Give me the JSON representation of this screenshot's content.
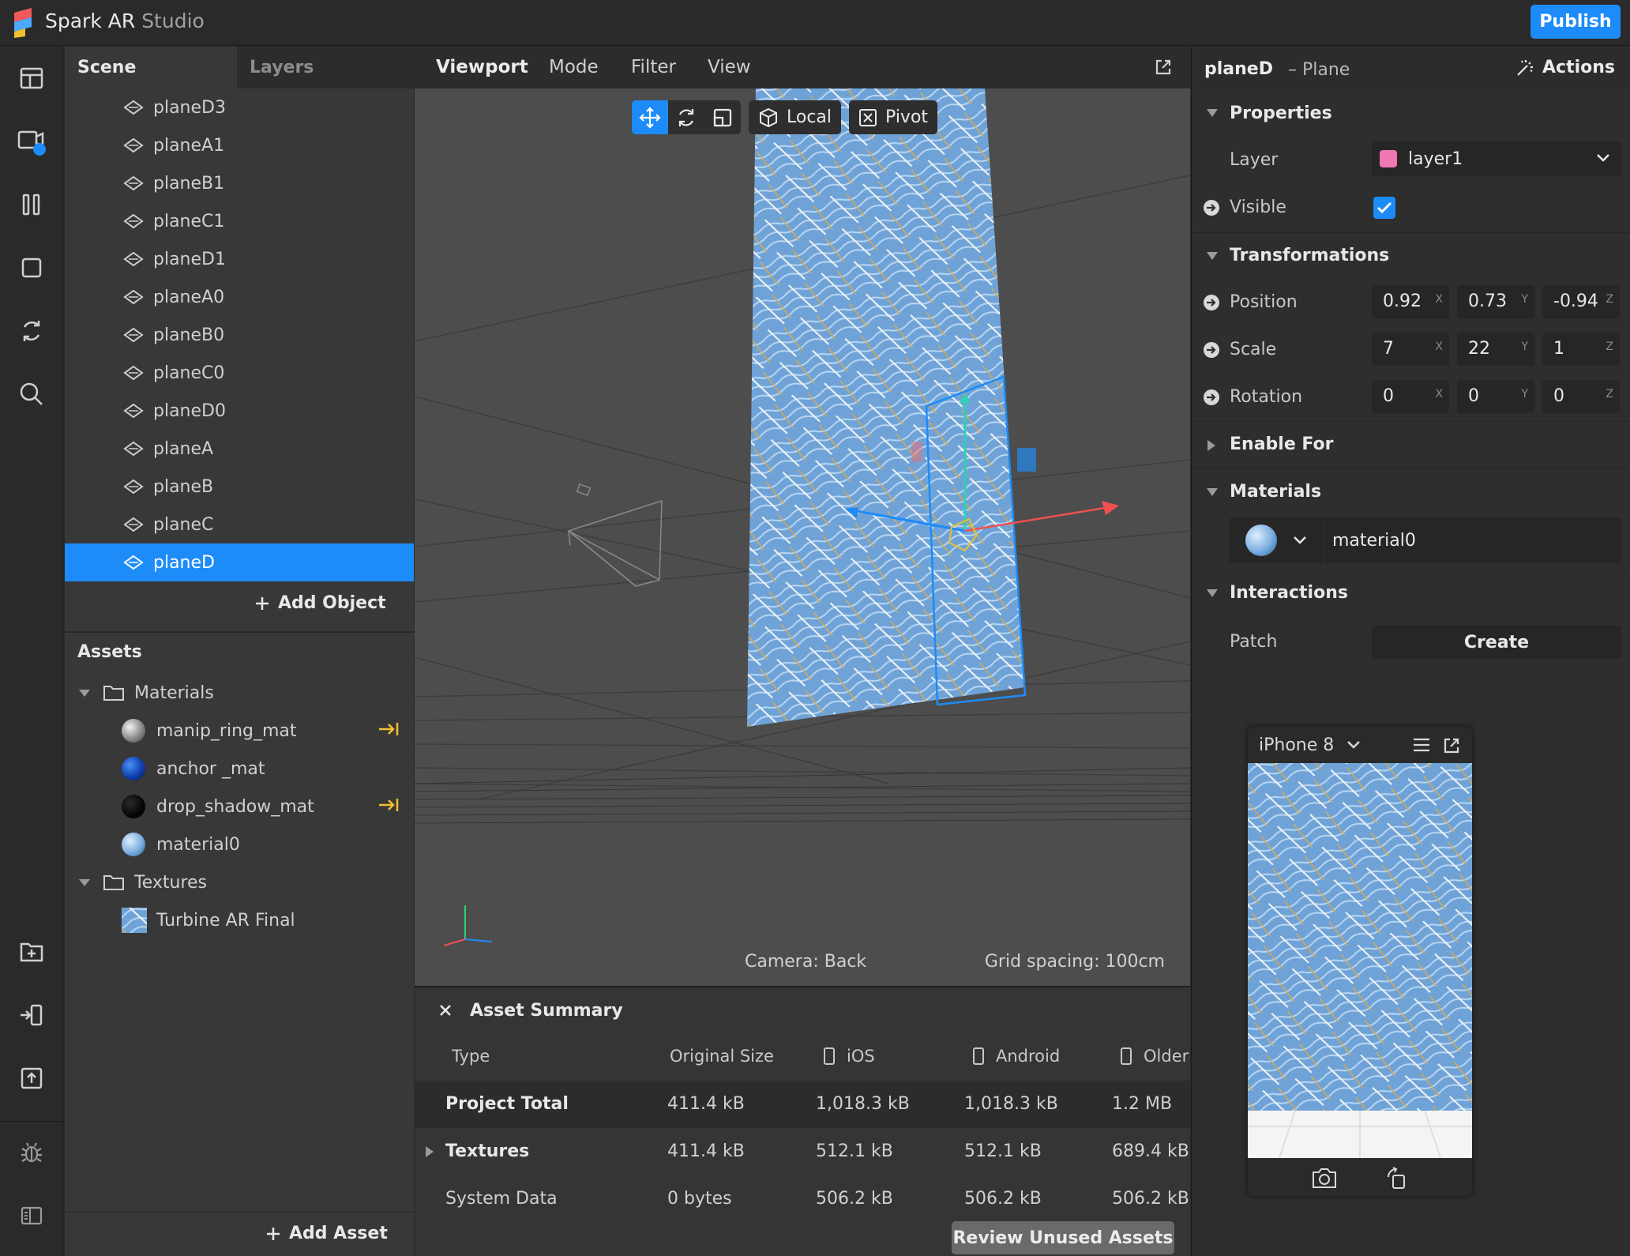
{
  "app": {
    "name": "Spark AR",
    "name_suffix": "Studio",
    "publish_label": "Publish"
  },
  "colors": {
    "accent": "#1d8cf8",
    "layer_swatch": "#f078b4",
    "gizmo_x": "#f05050",
    "gizmo_y": "#30d0b0",
    "gizmo_z": "#1d8cf8",
    "link_arrow": "#f0c030"
  },
  "toolbar": {
    "icons": [
      "layout-icon",
      "video-icon",
      "columns-icon",
      "square-icon",
      "refresh-icon",
      "search-icon",
      "folder-add-icon",
      "import-icon",
      "upload-icon",
      "bug-icon",
      "panel-icon"
    ]
  },
  "scene": {
    "tab_scene": "Scene",
    "tab_layers": "Layers",
    "items": [
      "planeD3",
      "planeA1",
      "planeB1",
      "planeC1",
      "planeD1",
      "planeA0",
      "planeB0",
      "planeC0",
      "planeD0",
      "planeA",
      "planeB",
      "planeC",
      "planeD"
    ],
    "selected": "planeD",
    "add_object": "Add Object"
  },
  "assets": {
    "title": "Assets",
    "folder_materials": "Materials",
    "materials": [
      "manip_ring_mat",
      "anchor _mat",
      "drop_shadow_mat",
      "material0"
    ],
    "folder_textures": "Textures",
    "textures": [
      "Turbine AR Final"
    ],
    "add_asset": "Add Asset"
  },
  "viewport": {
    "tab": "Viewport",
    "menu": [
      "Mode",
      "Filter",
      "View"
    ],
    "local_label": "Local",
    "pivot_label": "Pivot",
    "camera_label": "Camera: Back",
    "grid_label": "Grid spacing: 100cm"
  },
  "summary": {
    "title": "Asset Summary",
    "columns": [
      "Type",
      "Original Size",
      "iOS",
      "Android",
      "Older"
    ],
    "rows": [
      {
        "name": "Project Total",
        "original": "411.4 kB",
        "ios": "1,018.3 kB",
        "android": "1,018.3 kB",
        "older": "1.2 MB"
      },
      {
        "name": "Textures",
        "original": "411.4 kB",
        "ios": "512.1 kB",
        "android": "512.1 kB",
        "older": "689.4 kB"
      },
      {
        "name": "System Data",
        "original": "0 bytes",
        "ios": "506.2 kB",
        "android": "506.2 kB",
        "older": "506.2 kB"
      }
    ],
    "review_label": "Review Unused Assets"
  },
  "inspector": {
    "object_name": "planeD",
    "object_type": "– Plane",
    "actions_label": "Actions",
    "properties_label": "Properties",
    "layer_label": "Layer",
    "layer_value": "layer1",
    "visible_label": "Visible",
    "transformations_label": "Transformations",
    "position_label": "Position",
    "position": [
      "0.92",
      "0.73",
      "-0.94"
    ],
    "scale_label": "Scale",
    "scale": [
      "7",
      "22",
      "1"
    ],
    "rotation_label": "Rotation",
    "rotation": [
      "0",
      "0",
      "0"
    ],
    "axis": [
      "X",
      "Y",
      "Z"
    ],
    "enable_for_label": "Enable For",
    "materials_label": "Materials",
    "material_value": "material0",
    "interactions_label": "Interactions",
    "patch_label": "Patch",
    "create_label": "Create"
  },
  "preview": {
    "device": "iPhone 8"
  }
}
